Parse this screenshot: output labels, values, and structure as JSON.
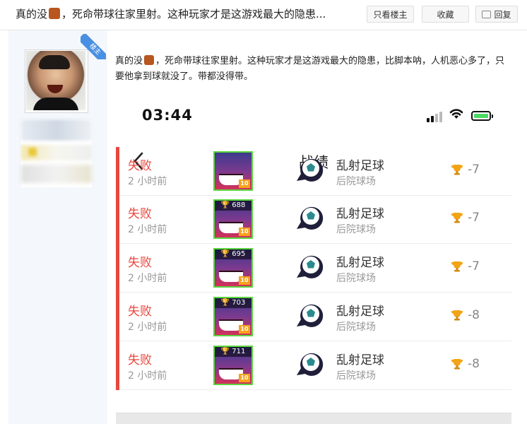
{
  "header": {
    "title_part1": "真的没",
    "title_part2": "，死命带球往家里射。这种玩家才是这游戏最大的隐患...",
    "only_op_label": "只看楼主",
    "favorite_label": "收藏",
    "reply_label": "回复"
  },
  "author": {
    "badge": "楼主"
  },
  "post": {
    "text_part1": "真的没",
    "text_part2": "，死命带球往家里射。这种玩家才是这游戏最大的隐患，比脚本呐，人机恶心多了，只要他拿到球就没了。带都没得带。"
  },
  "phone": {
    "time": "03:44",
    "nav_title": "战绩",
    "rows": [
      {
        "result": "失败",
        "time": "2 小时前",
        "trophies": "",
        "level": "10",
        "mode": "乱射足球",
        "map": "后院球场",
        "change": "-7"
      },
      {
        "result": "失败",
        "time": "2 小时前",
        "trophies": "688",
        "level": "10",
        "mode": "乱射足球",
        "map": "后院球场",
        "change": "-7"
      },
      {
        "result": "失败",
        "time": "2 小时前",
        "trophies": "695",
        "level": "10",
        "mode": "乱射足球",
        "map": "后院球场",
        "change": "-7"
      },
      {
        "result": "失败",
        "time": "2 小时前",
        "trophies": "703",
        "level": "10",
        "mode": "乱射足球",
        "map": "后院球场",
        "change": "-8"
      },
      {
        "result": "失败",
        "time": "2 小时前",
        "trophies": "711",
        "level": "10",
        "mode": "乱射足球",
        "map": "后院球场",
        "change": "-8"
      }
    ]
  },
  "colors": {
    "loss": "#e8473e",
    "accent": "#4a90e2",
    "brawler_border": "#5ad43f"
  }
}
